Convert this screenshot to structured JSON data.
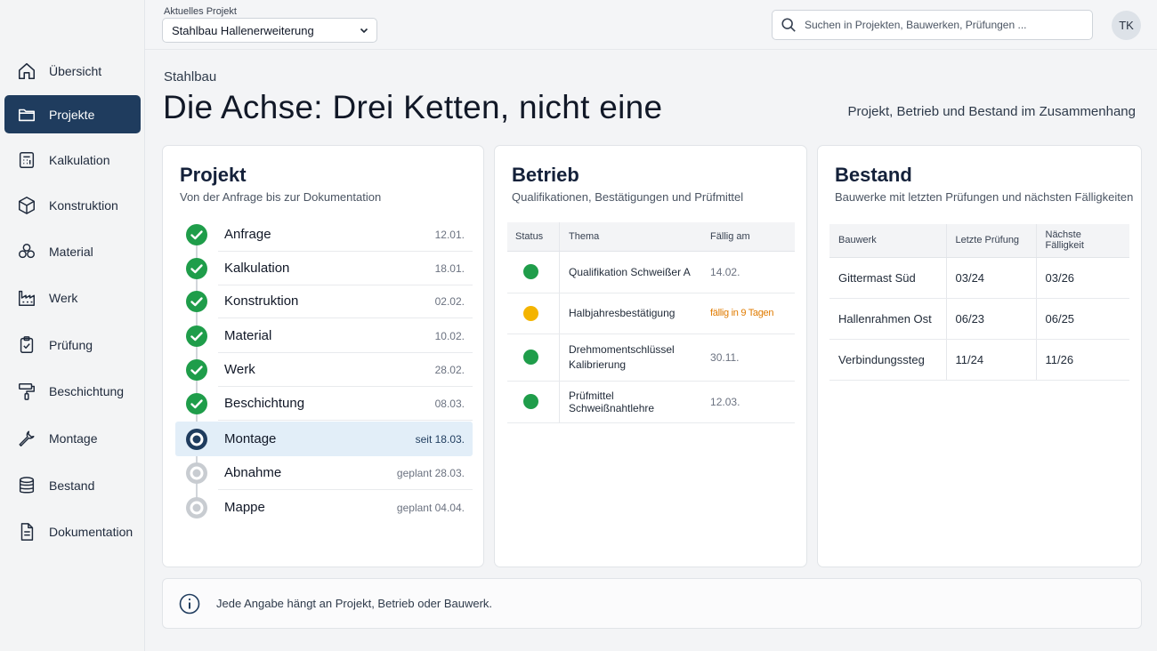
{
  "topbar": {
    "project_label": "Aktuelles Projekt",
    "project_value": "Stahlbau Hallenerweiterung",
    "search_placeholder": "Suchen in Projekten, Bauwerken, Prüfungen ...",
    "avatar_initials": "TK"
  },
  "sidebar": {
    "active_color": "#1f3c5e",
    "items": [
      {
        "label": "Übersicht",
        "icon": "home-icon"
      },
      {
        "label": "Projekte",
        "icon": "folder-icon",
        "active": true
      },
      {
        "label": "Kalkulation",
        "icon": "calculator-icon"
      },
      {
        "label": "Konstruktion",
        "icon": "cube-icon"
      },
      {
        "label": "Material",
        "icon": "stack-icon"
      },
      {
        "label": "Werk",
        "icon": "factory-icon"
      },
      {
        "label": "Prüfung",
        "icon": "clipboard-check-icon"
      },
      {
        "label": "Beschichtung",
        "icon": "paint-roller-icon"
      },
      {
        "label": "Montage",
        "icon": "wrench-icon"
      },
      {
        "label": "Bestand",
        "icon": "database-icon"
      },
      {
        "label": "Dokumentation",
        "icon": "document-icon"
      }
    ]
  },
  "header": {
    "breadcrumb": "Stahlbau",
    "title": "Die Achse: Drei Ketten, nicht eine",
    "subtitle": "Projekt, Betrieb und Bestand im Zusammenhang"
  },
  "projekt": {
    "title": "Projekt",
    "subtitle": "Von der Anfrage bis zur Dokumentation",
    "steps": [
      {
        "label": "Anfrage",
        "date": "12.01.",
        "status": "done"
      },
      {
        "label": "Kalkulation",
        "date": "18.01.",
        "status": "done"
      },
      {
        "label": "Konstruktion",
        "date": "02.02.",
        "status": "done"
      },
      {
        "label": "Material",
        "date": "10.02.",
        "status": "done"
      },
      {
        "label": "Werk",
        "date": "28.02.",
        "status": "done"
      },
      {
        "label": "Beschichtung",
        "date": "08.03.",
        "status": "done"
      },
      {
        "label": "Montage",
        "date": "seit 18.03.",
        "status": "current"
      },
      {
        "label": "Abnahme",
        "date": "geplant 28.03.",
        "status": "planned"
      },
      {
        "label": "Mappe",
        "date": "geplant 04.04.",
        "status": "planned"
      }
    ]
  },
  "betrieb": {
    "title": "Betrieb",
    "subtitle": "Qualifikationen, Bestätigungen und Prüfmittel",
    "headers": {
      "status": "Status",
      "thema": "Thema",
      "faellig": "Fällig am"
    },
    "rows": [
      {
        "status": "green",
        "thema": "Qualifikation Schweißer A",
        "faellig": "14.02."
      },
      {
        "status": "yellow",
        "thema": "Halbjahresbestätigung",
        "faellig": "fällig in 9 Tagen"
      },
      {
        "status": "green",
        "thema": "Drehmomentschlüssel Kalibrierung",
        "faellig": "30.11."
      },
      {
        "status": "green",
        "thema": "Prüfmittel Schweißnahtlehre",
        "faellig": "12.03."
      }
    ],
    "colors": {
      "green": "#1f9d4a",
      "yellow": "#f4b400",
      "warn_text": "#e07b00"
    }
  },
  "bestand": {
    "title": "Bestand",
    "subtitle": "Bauwerke mit letzten Prüfungen und nächsten Fälligkeiten",
    "headers": {
      "bauwerk": "Bauwerk",
      "letzte": "Letzte Prüfung",
      "naechste": "Nächste Fälligkeit"
    },
    "rows": [
      {
        "bauwerk": "Gittermast Süd",
        "letzte": "03/24",
        "naechste": "03/26"
      },
      {
        "bauwerk": "Hallenrahmen Ost",
        "letzte": "06/23",
        "naechste": "06/25"
      },
      {
        "bauwerk": "Verbindungssteg",
        "letzte": "11/24",
        "naechste": "11/26"
      }
    ]
  },
  "footer": {
    "icon": "info-icon",
    "text": "Jede Angabe hängt an Projekt, Betrieb oder Bauwerk."
  }
}
